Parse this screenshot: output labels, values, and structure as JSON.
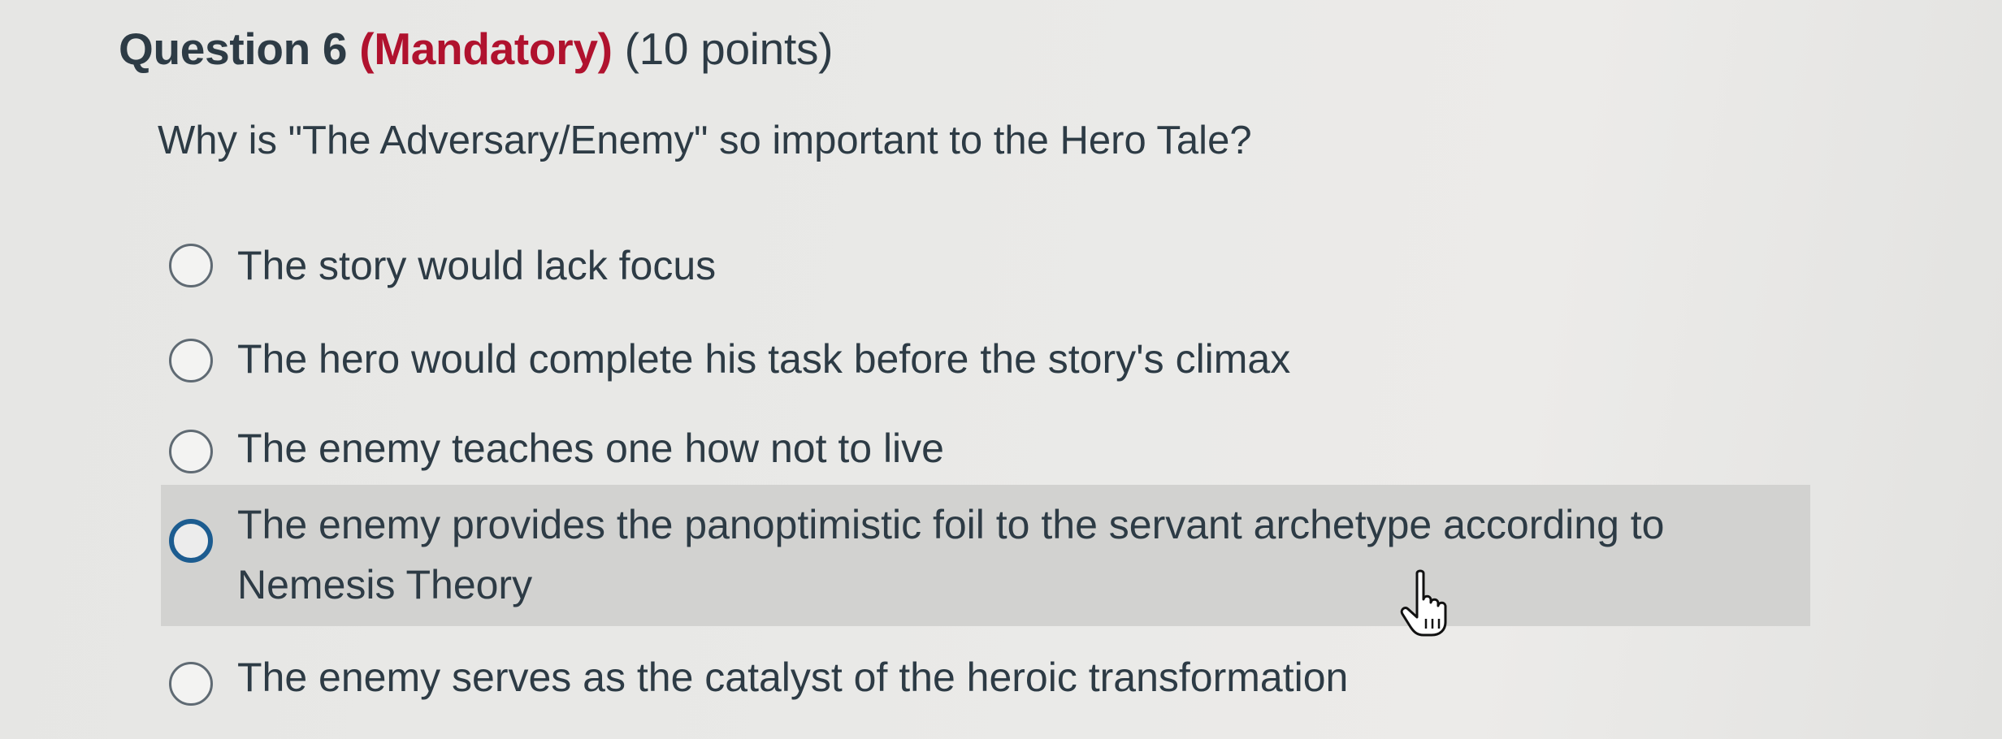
{
  "question": {
    "number_label": "Question 6",
    "mandatory_label": "(Mandatory)",
    "points_label": "(10 points)",
    "prompt": "Why is \"The Adversary/Enemy\" so important to the Hero Tale?"
  },
  "answers": [
    {
      "label": "The story would lack focus",
      "selected": false
    },
    {
      "label": "The hero would complete his task before the story's climax",
      "selected": false
    },
    {
      "label": "The enemy teaches one how not to live",
      "selected": false
    },
    {
      "label": "The enemy provides the panoptimistic foil to the servant archetype according to Nemesis Theory",
      "selected": false
    },
    {
      "label": "The enemy serves as the catalyst of the heroic transformation",
      "selected": false
    }
  ],
  "cursor": {
    "icon": "hand-pointer-icon"
  },
  "colors": {
    "text": "#2d3b45",
    "mandatory": "#b0122e",
    "hover_background": "#d2d2d0",
    "hover_radio_border": "#1c5c90"
  }
}
